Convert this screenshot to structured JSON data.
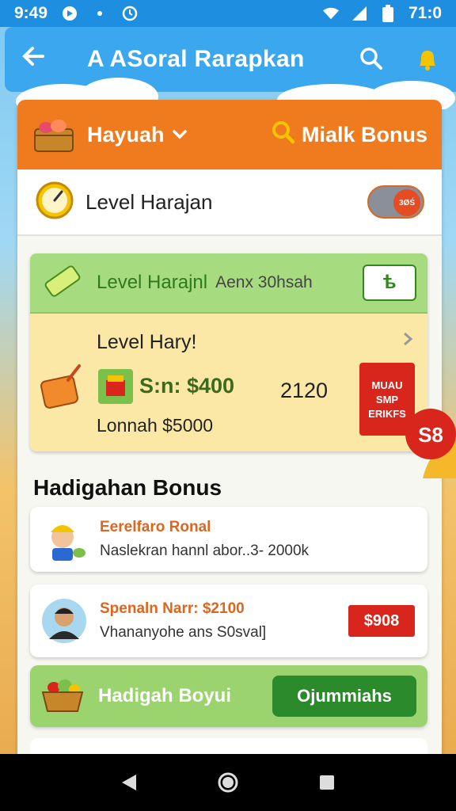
{
  "status_bar": {
    "time": "9:49",
    "battery_text": "71:0",
    "icons": [
      "app-notification-icon",
      "dot-icon",
      "clock-icon",
      "wifi-icon",
      "signal-icon",
      "battery-icon"
    ]
  },
  "app_bar": {
    "title": "A ASoral Rarapkan",
    "icons": [
      "back-arrow-icon",
      "search-icon",
      "bell-icon"
    ]
  },
  "card_header": {
    "dropdown_label": "Hayuah",
    "bonus_label": "Mialk Bonus",
    "icons": [
      "basket-icon",
      "chevron-down-icon",
      "search-icon"
    ]
  },
  "level_row": {
    "label": "Level Harajan",
    "toggle_text": "3ØŚ",
    "icons": [
      "gauge-icon"
    ]
  },
  "promo": {
    "top_label": "Level Harajnl",
    "top_sub": "Aenx 30hsah",
    "top_button": "ѣ",
    "body_title": "Level Hary!",
    "price": "S:n: $400",
    "number": "2120",
    "red_button_lines": [
      "MUAU",
      "SMP",
      "ERIKFS"
    ],
    "footer": "Lonnah $5000",
    "icons": [
      "ticket-icon",
      "gift-icon",
      "box-icon",
      "chevron-right-icon"
    ]
  },
  "section_title": "Hadigahan Bonus",
  "list_items": [
    {
      "title": "Eerelfaro Ronal",
      "subtitle": "Naslekran hannl abor..3- 2000k",
      "badge": "S8",
      "avatar_icon": "worker-avatar-icon"
    },
    {
      "title": "Spenaln Narr: $2100",
      "subtitle": "Vhananyohe ans S0sval]",
      "price": "$908",
      "avatar_icon": "man-avatar-icon"
    }
  ],
  "bottom_promo": {
    "label": "Hadigah Boyui",
    "button": "Ojummiahs",
    "icons": [
      "fruit-basket-icon"
    ]
  },
  "nav_bar": {
    "icons": [
      "back-nav-icon",
      "home-nav-icon",
      "recents-nav-icon"
    ]
  },
  "colors": {
    "status_bar": "#1e8ee0",
    "app_bar": "#3aa7ee",
    "card_header": "#f07a1e",
    "promo_green": "#a6db7f",
    "promo_yellow": "#fbe7a6",
    "red_accent": "#d9261c",
    "green_button": "#2b8a2a"
  }
}
